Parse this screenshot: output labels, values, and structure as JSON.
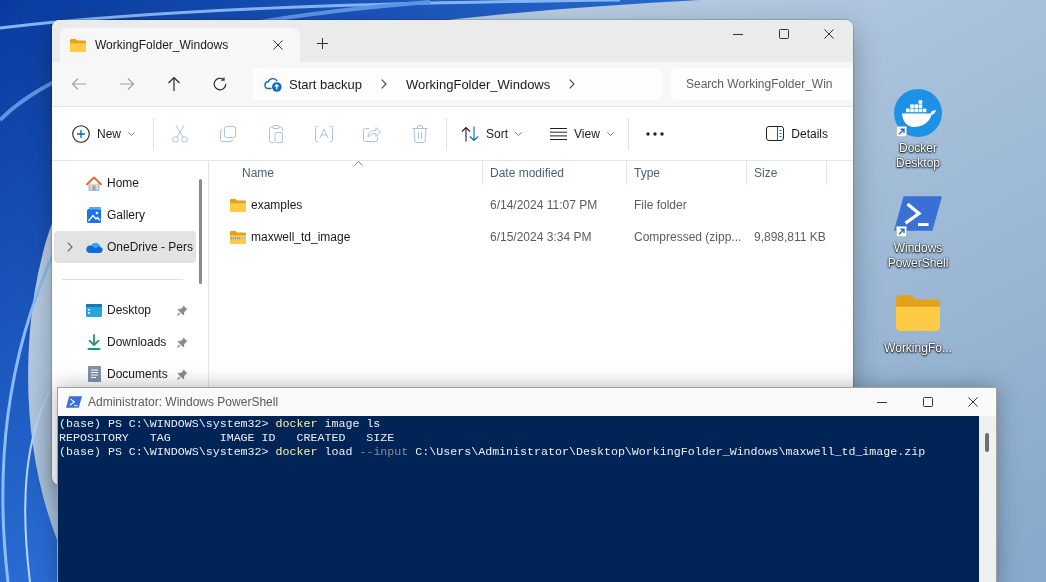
{
  "desktop": {
    "icons": [
      {
        "kind": "docker",
        "label": "Docker Desktop",
        "shortcut": true
      },
      {
        "kind": "powershell",
        "label": "Windows PowerShell",
        "shortcut": true
      },
      {
        "kind": "folder",
        "label": "WorkingFo...",
        "shortcut": false
      }
    ]
  },
  "explorer": {
    "tabs": [
      {
        "label": "WorkingFolder_Windows",
        "selected": true
      }
    ],
    "nav_buttons": [
      {
        "kind": "back",
        "disabled": true
      },
      {
        "kind": "forward",
        "disabled": true
      },
      {
        "kind": "up",
        "disabled": false
      },
      {
        "kind": "refresh",
        "disabled": false
      }
    ],
    "address": {
      "segments": [
        {
          "kind": "backup",
          "label": "Start backup"
        },
        {
          "kind": "folder",
          "label": "WorkingFolder_Windows"
        }
      ]
    },
    "search": {
      "placeholder": "Search WorkingFolder_Win"
    },
    "command_bar": {
      "groups": [
        {
          "items": [
            {
              "kind": "new",
              "label": "New",
              "dropdown": true,
              "disabled": false
            }
          ]
        },
        {
          "items": [
            {
              "kind": "cut",
              "disabled": true
            },
            {
              "kind": "copy",
              "disabled": true
            },
            {
              "kind": "paste",
              "disabled": true
            },
            {
              "kind": "rename",
              "disabled": true
            },
            {
              "kind": "share",
              "disabled": true
            },
            {
              "kind": "delete",
              "disabled": true
            }
          ]
        },
        {
          "items": [
            {
              "kind": "sort",
              "label": "Sort",
              "dropdown": true,
              "disabled": false
            },
            {
              "kind": "view",
              "label": "View",
              "dropdown": true,
              "disabled": false
            }
          ]
        },
        {
          "items": [
            {
              "kind": "more",
              "disabled": false
            }
          ]
        }
      ],
      "details": {
        "label": "Details"
      }
    },
    "nav": {
      "sections": [
        {
          "items": [
            {
              "kind": "home",
              "label": "Home",
              "selected": false,
              "expandable": false,
              "pinned": false
            },
            {
              "kind": "gallery",
              "label": "Gallery",
              "selected": false,
              "expandable": false,
              "pinned": false
            },
            {
              "kind": "onedrive",
              "label": "OneDrive - Pers",
              "selected": true,
              "expandable": true,
              "pinned": false
            }
          ]
        },
        {
          "items": [
            {
              "kind": "desktop",
              "label": "Desktop",
              "selected": false,
              "expandable": false,
              "pinned": true
            },
            {
              "kind": "downloads",
              "label": "Downloads",
              "selected": false,
              "expandable": false,
              "pinned": true
            },
            {
              "kind": "documents",
              "label": "Documents",
              "selected": false,
              "expandable": false,
              "pinned": true
            }
          ]
        }
      ]
    },
    "file_list": {
      "columns": [
        {
          "label": "Name",
          "sorted": true
        },
        {
          "label": "Date modified",
          "sorted": false
        },
        {
          "label": "Type",
          "sorted": false
        },
        {
          "label": "Size",
          "sorted": false
        }
      ],
      "rows": [
        {
          "kind": "folder",
          "name": "examples",
          "date_modified": "6/14/2024 11:07 PM",
          "type": "File folder"
        },
        {
          "kind": "zip",
          "name": "maxwell_td_image",
          "date_modified": "6/15/2024 3:34 PM",
          "type": "Compressed (zipp...",
          "size": "9,898,811 KB"
        }
      ]
    }
  },
  "powershell": {
    "title": "Administrator: Windows PowerShell",
    "lines": [
      {
        "segments": [
          {
            "kind": "text",
            "text": "(base) PS C:\\WINDOWS\\system32> "
          },
          {
            "kind": "command",
            "text": "docker"
          },
          {
            "kind": "text",
            "text": " image ls"
          }
        ]
      },
      {
        "segments": [
          {
            "kind": "text",
            "text": "REPOSITORY   TAG       IMAGE ID   CREATED   SIZE"
          }
        ]
      },
      {
        "segments": [
          {
            "kind": "text",
            "text": "(base) PS C:\\WINDOWS\\system32> "
          },
          {
            "kind": "command",
            "text": "docker"
          },
          {
            "kind": "text",
            "text": " load "
          },
          {
            "kind": "parameter",
            "text": "--input"
          },
          {
            "kind": "text",
            "text": " C:\\Users\\Administrator\\Desktop\\WorkingFolder_Windows\\maxwell_td_image.zip"
          }
        ]
      }
    ]
  }
}
